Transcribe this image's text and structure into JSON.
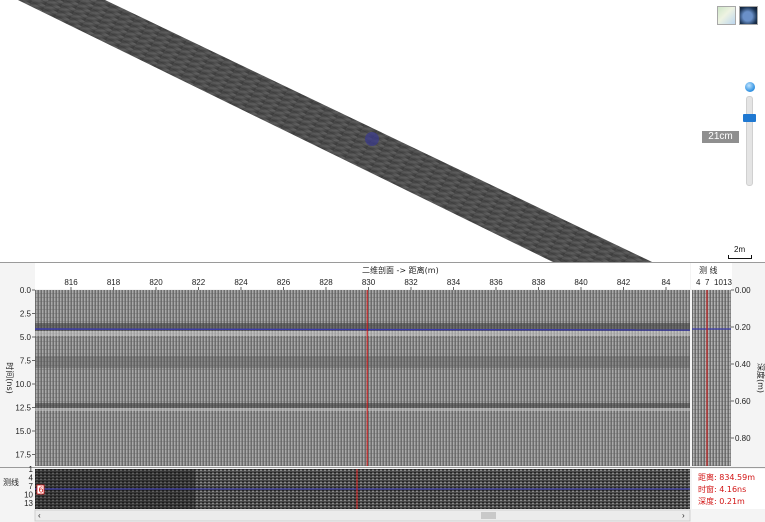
{
  "map_panel": {
    "scale_value": "21cm",
    "scalebar_label": "2m",
    "icons": {
      "map_layer": "map-layer-icon",
      "satellite_layer": "satellite-layer-icon",
      "zoom": "zoom-slider-icon"
    }
  },
  "profile_panel": {
    "title": "二维剖面 -> 距离(m)",
    "x_ticks": [
      "816",
      "818",
      "820",
      "822",
      "824",
      "826",
      "828",
      "830",
      "832",
      "834",
      "836",
      "838",
      "840",
      "842",
      "84"
    ],
    "y_left_ticks": [
      "0.0",
      "2.5",
      "5.0",
      "7.5",
      "10.0",
      "12.5",
      "15.0",
      "17.5"
    ],
    "y_left_label": "时间(ns)",
    "y_right_ticks": [
      "0.00",
      "0.20",
      "0.40",
      "0.60",
      "0.80"
    ],
    "y_right_label": "深度(m)",
    "cursor_distance": 829.0,
    "x_range": [
      815.0,
      842.6
    ]
  },
  "line_panel": {
    "header": "测 线",
    "ticks": [
      "4",
      "7",
      "10",
      "13"
    ]
  },
  "strip_panel": {
    "label": "测线",
    "ticks": [
      "1",
      "4",
      "7",
      "10",
      "13"
    ],
    "selected_line": "6"
  },
  "readout": {
    "distance": "距离: 834.59m",
    "time_window": "时窗: 4.16ns",
    "depth": "深度: 0.21m"
  },
  "colors": {
    "accent": "#1f78d1",
    "cursor": "#d21414",
    "horizon": "#3a3aa8"
  }
}
